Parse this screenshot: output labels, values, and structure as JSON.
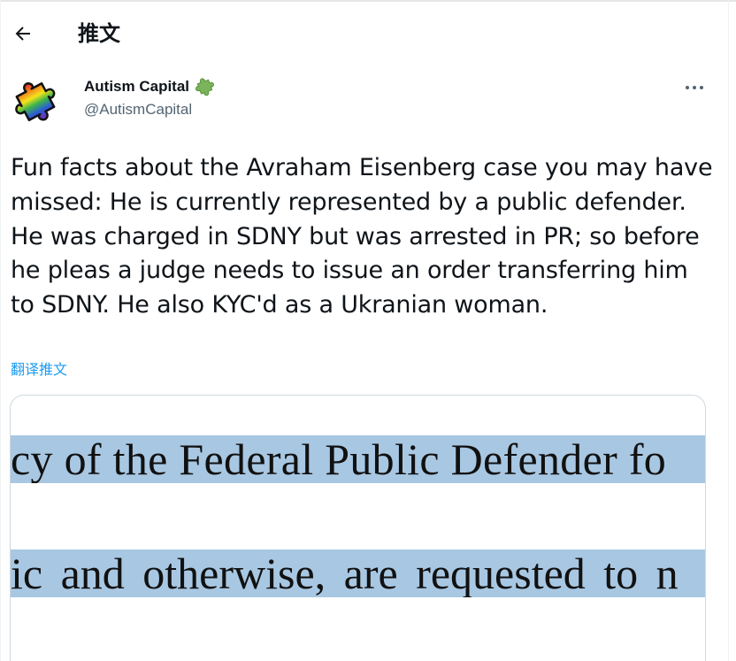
{
  "header": {
    "title": "推文",
    "back_icon": "arrow-left-icon"
  },
  "tweet": {
    "author": {
      "name": "Autism Capital",
      "handle": "@AutismCapital",
      "avatar_icon": "rainbow-puzzle-piece",
      "verified_icon": "green-puzzle-piece-badge"
    },
    "more_label": "···",
    "text": "Fun facts about the Avraham Eisenberg case you may have missed: He is currently represented by a public defender. He was charged in SDNY but was arrested in PR; so before he pleas a judge needs to issue an order transferring him to SDNY. He also KYC'd as a Ukranian woman.",
    "translate_label": "翻译推文",
    "media": {
      "line1": "cy of the Federal Public Defender fo",
      "line2": "ic and otherwise, are requested to n"
    }
  },
  "colors": {
    "text": "#0f1419",
    "secondary": "#536471",
    "link": "#1d9bf0",
    "highlight": "#a8c7e2",
    "verified": "#7cb45c"
  }
}
